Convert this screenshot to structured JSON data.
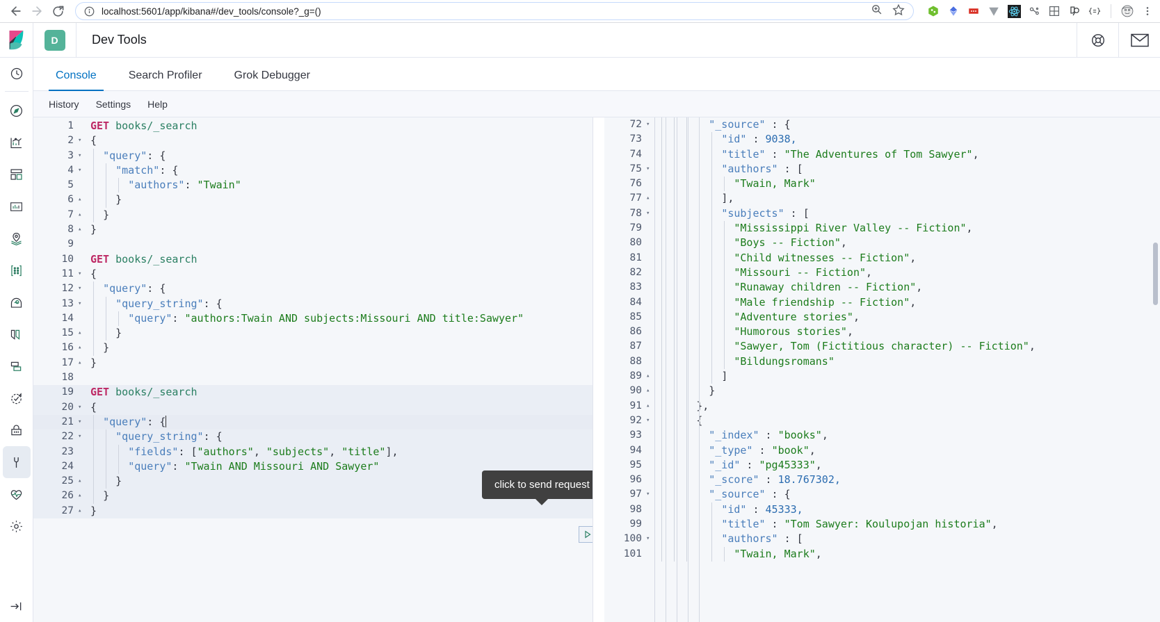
{
  "browser": {
    "back_label": "Back",
    "forward_label": "Forward",
    "reload_label": "Reload",
    "url": "localhost:5601/app/kibana#/dev_tools/console?_g=()",
    "site_info_icon": "info-circle-icon",
    "zoom_icon": "zoom-in-icon",
    "bookmark_icon": "star-icon",
    "menu_icon": "kebab-menu-icon",
    "extensions": [
      "puzzle-green-icon",
      "diamond-blue-icon",
      "red-dots-icon",
      "v-grey-icon",
      "react-atom-icon",
      "graph-nodes-icon",
      "grid-table-icon",
      "magnifier-person-icon",
      "braces-icon"
    ],
    "profile_icon": "avatar-icon"
  },
  "header": {
    "logo_icon": "kibana-logo-icon",
    "app_badge": "D",
    "title": "Dev Tools",
    "help_icon": "lifebuoy-icon",
    "mail_icon": "envelope-icon"
  },
  "sidebar": {
    "items": [
      {
        "name": "recently-viewed",
        "icon": "clock-icon",
        "selected": false
      },
      {
        "name": "discover",
        "icon": "compass-icon",
        "selected": false
      },
      {
        "name": "visualize",
        "icon": "chart-icon",
        "selected": false
      },
      {
        "name": "dashboard",
        "icon": "dashboard-icon",
        "selected": false
      },
      {
        "name": "canvas",
        "icon": "canvas-icon",
        "selected": false
      },
      {
        "name": "maps",
        "icon": "map-pin-icon",
        "selected": false
      },
      {
        "name": "machine-learning",
        "icon": "ml-nodes-icon",
        "selected": false
      },
      {
        "name": "infrastructure",
        "icon": "infra-icon",
        "selected": false
      },
      {
        "name": "logs",
        "icon": "logs-icon",
        "selected": false
      },
      {
        "name": "apm",
        "icon": "apm-icon",
        "selected": false
      },
      {
        "name": "uptime",
        "icon": "uptime-check-icon",
        "selected": false
      },
      {
        "name": "siem",
        "icon": "lock-icon",
        "selected": false
      },
      {
        "name": "dev-tools",
        "icon": "wrench-icon",
        "selected": true
      },
      {
        "name": "monitoring",
        "icon": "heart-pulse-icon",
        "selected": false
      },
      {
        "name": "management",
        "icon": "gear-icon",
        "selected": false
      }
    ],
    "collapse_icon": "collapse-arrow-icon"
  },
  "tabs": [
    {
      "label": "Console",
      "active": true
    },
    {
      "label": "Search Profiler",
      "active": false
    },
    {
      "label": "Grok Debugger",
      "active": false
    }
  ],
  "subbar": [
    {
      "label": "History"
    },
    {
      "label": "Settings"
    },
    {
      "label": "Help"
    }
  ],
  "tooltip": {
    "text": "click to send request"
  },
  "editor_actions": {
    "play_icon": "play-triangle-icon",
    "wrench_icon": "wrench-icon"
  },
  "editor": {
    "lines": [
      {
        "n": 1,
        "fold": "",
        "indent": 0,
        "tokens": [
          {
            "t": "method",
            "v": "GET"
          },
          {
            "t": "plain",
            "v": " "
          },
          {
            "t": "url",
            "v": "books/_search"
          }
        ]
      },
      {
        "n": 2,
        "fold": "▾",
        "indent": 0,
        "tokens": [
          {
            "t": "punc",
            "v": "{"
          }
        ]
      },
      {
        "n": 3,
        "fold": "▾",
        "indent": 1,
        "tokens": [
          {
            "t": "key",
            "v": "\"query\""
          },
          {
            "t": "punc",
            "v": ": {"
          }
        ]
      },
      {
        "n": 4,
        "fold": "▾",
        "indent": 2,
        "tokens": [
          {
            "t": "key",
            "v": "\"match\""
          },
          {
            "t": "punc",
            "v": ": {"
          }
        ]
      },
      {
        "n": 5,
        "fold": "",
        "indent": 3,
        "tokens": [
          {
            "t": "key",
            "v": "\"authors\""
          },
          {
            "t": "punc",
            "v": ": "
          },
          {
            "t": "str",
            "v": "\"Twain\""
          }
        ]
      },
      {
        "n": 6,
        "fold": "▴",
        "indent": 2,
        "tokens": [
          {
            "t": "punc",
            "v": "}"
          }
        ]
      },
      {
        "n": 7,
        "fold": "▴",
        "indent": 1,
        "tokens": [
          {
            "t": "punc",
            "v": "}"
          }
        ]
      },
      {
        "n": 8,
        "fold": "▴",
        "indent": 0,
        "tokens": [
          {
            "t": "punc",
            "v": "}"
          }
        ]
      },
      {
        "n": 9,
        "fold": "",
        "indent": 0,
        "tokens": []
      },
      {
        "n": 10,
        "fold": "",
        "indent": 0,
        "tokens": [
          {
            "t": "method",
            "v": "GET"
          },
          {
            "t": "plain",
            "v": " "
          },
          {
            "t": "url",
            "v": "books/_search"
          }
        ]
      },
      {
        "n": 11,
        "fold": "▾",
        "indent": 0,
        "tokens": [
          {
            "t": "punc",
            "v": "{"
          }
        ]
      },
      {
        "n": 12,
        "fold": "▾",
        "indent": 1,
        "tokens": [
          {
            "t": "key",
            "v": "\"query\""
          },
          {
            "t": "punc",
            "v": ": {"
          }
        ]
      },
      {
        "n": 13,
        "fold": "▾",
        "indent": 2,
        "tokens": [
          {
            "t": "key",
            "v": "\"query_string\""
          },
          {
            "t": "punc",
            "v": ": {"
          }
        ]
      },
      {
        "n": 14,
        "fold": "",
        "indent": 3,
        "tokens": [
          {
            "t": "key",
            "v": "\"query\""
          },
          {
            "t": "punc",
            "v": ": "
          },
          {
            "t": "str",
            "v": "\"authors:Twain AND subjects:Missouri AND title:Sawyer\""
          }
        ]
      },
      {
        "n": 15,
        "fold": "▴",
        "indent": 2,
        "tokens": [
          {
            "t": "punc",
            "v": "}"
          }
        ]
      },
      {
        "n": 16,
        "fold": "▴",
        "indent": 1,
        "tokens": [
          {
            "t": "punc",
            "v": "}"
          }
        ]
      },
      {
        "n": 17,
        "fold": "▴",
        "indent": 0,
        "tokens": [
          {
            "t": "punc",
            "v": "}"
          }
        ]
      },
      {
        "n": 18,
        "fold": "",
        "indent": 0,
        "tokens": []
      },
      {
        "n": 19,
        "fold": "",
        "indent": 0,
        "hl": true,
        "tokens": [
          {
            "t": "method",
            "v": "GET"
          },
          {
            "t": "plain",
            "v": " "
          },
          {
            "t": "url",
            "v": "books/_search"
          }
        ]
      },
      {
        "n": 20,
        "fold": "▾",
        "indent": 0,
        "hl": true,
        "tokens": [
          {
            "t": "punc",
            "v": "{"
          }
        ]
      },
      {
        "n": 21,
        "fold": "▾",
        "indent": 1,
        "cursor": true,
        "active": true,
        "tokens": [
          {
            "t": "key",
            "v": "\"query\""
          },
          {
            "t": "punc",
            "v": ": {"
          }
        ]
      },
      {
        "n": 22,
        "fold": "▾",
        "indent": 2,
        "hl": true,
        "tokens": [
          {
            "t": "key",
            "v": "\"query_string\""
          },
          {
            "t": "punc",
            "v": ": {"
          }
        ]
      },
      {
        "n": 23,
        "fold": "",
        "indent": 3,
        "hl": true,
        "tokens": [
          {
            "t": "key",
            "v": "\"fields\""
          },
          {
            "t": "punc",
            "v": ": ["
          },
          {
            "t": "str",
            "v": "\"authors\""
          },
          {
            "t": "punc",
            "v": ", "
          },
          {
            "t": "str",
            "v": "\"subjects\""
          },
          {
            "t": "punc",
            "v": ", "
          },
          {
            "t": "str",
            "v": "\"title\""
          },
          {
            "t": "punc",
            "v": "],"
          }
        ]
      },
      {
        "n": 24,
        "fold": "",
        "indent": 3,
        "hl": true,
        "tokens": [
          {
            "t": "key",
            "v": "\"query\""
          },
          {
            "t": "punc",
            "v": ": "
          },
          {
            "t": "str",
            "v": "\"Twain AND Missouri AND Sawyer\""
          }
        ]
      },
      {
        "n": 25,
        "fold": "▴",
        "indent": 2,
        "hl": true,
        "tokens": [
          {
            "t": "punc",
            "v": "}"
          }
        ]
      },
      {
        "n": 26,
        "fold": "▴",
        "indent": 1,
        "hl": true,
        "tokens": [
          {
            "t": "punc",
            "v": "}"
          }
        ]
      },
      {
        "n": 27,
        "fold": "▴",
        "indent": 0,
        "hl": true,
        "tokens": [
          {
            "t": "punc",
            "v": "}"
          }
        ]
      }
    ]
  },
  "output": {
    "lines": [
      {
        "n": 72,
        "fold": "▾",
        "indent": 4,
        "tokens": [
          {
            "t": "key",
            "v": "\"_source\""
          },
          {
            "t": "punc",
            "v": " : {"
          }
        ]
      },
      {
        "n": 73,
        "fold": "",
        "indent": 5,
        "tokens": [
          {
            "t": "key",
            "v": "\"id\""
          },
          {
            "t": "punc",
            "v": " : "
          },
          {
            "t": "num",
            "v": "9038,"
          }
        ]
      },
      {
        "n": 74,
        "fold": "",
        "indent": 5,
        "tokens": [
          {
            "t": "key",
            "v": "\"title\""
          },
          {
            "t": "punc",
            "v": " : "
          },
          {
            "t": "str",
            "v": "\"The Adventures of Tom Sawyer\""
          },
          {
            "t": "punc",
            "v": ","
          }
        ]
      },
      {
        "n": 75,
        "fold": "▾",
        "indent": 5,
        "tokens": [
          {
            "t": "key",
            "v": "\"authors\""
          },
          {
            "t": "punc",
            "v": " : ["
          }
        ]
      },
      {
        "n": 76,
        "fold": "",
        "indent": 6,
        "tokens": [
          {
            "t": "str",
            "v": "\"Twain, Mark\""
          }
        ]
      },
      {
        "n": 77,
        "fold": "▴",
        "indent": 5,
        "tokens": [
          {
            "t": "punc",
            "v": "],"
          }
        ]
      },
      {
        "n": 78,
        "fold": "▾",
        "indent": 5,
        "tokens": [
          {
            "t": "key",
            "v": "\"subjects\""
          },
          {
            "t": "punc",
            "v": " : ["
          }
        ]
      },
      {
        "n": 79,
        "fold": "",
        "indent": 6,
        "tokens": [
          {
            "t": "str",
            "v": "\"Mississippi River Valley -- Fiction\""
          },
          {
            "t": "punc",
            "v": ","
          }
        ]
      },
      {
        "n": 80,
        "fold": "",
        "indent": 6,
        "tokens": [
          {
            "t": "str",
            "v": "\"Boys -- Fiction\""
          },
          {
            "t": "punc",
            "v": ","
          }
        ]
      },
      {
        "n": 81,
        "fold": "",
        "indent": 6,
        "tokens": [
          {
            "t": "str",
            "v": "\"Child witnesses -- Fiction\""
          },
          {
            "t": "punc",
            "v": ","
          }
        ]
      },
      {
        "n": 82,
        "fold": "",
        "indent": 6,
        "tokens": [
          {
            "t": "str",
            "v": "\"Missouri -- Fiction\""
          },
          {
            "t": "punc",
            "v": ","
          }
        ]
      },
      {
        "n": 83,
        "fold": "",
        "indent": 6,
        "tokens": [
          {
            "t": "str",
            "v": "\"Runaway children -- Fiction\""
          },
          {
            "t": "punc",
            "v": ","
          }
        ]
      },
      {
        "n": 84,
        "fold": "",
        "indent": 6,
        "tokens": [
          {
            "t": "str",
            "v": "\"Male friendship -- Fiction\""
          },
          {
            "t": "punc",
            "v": ","
          }
        ]
      },
      {
        "n": 85,
        "fold": "",
        "indent": 6,
        "tokens": [
          {
            "t": "str",
            "v": "\"Adventure stories\""
          },
          {
            "t": "punc",
            "v": ","
          }
        ]
      },
      {
        "n": 86,
        "fold": "",
        "indent": 6,
        "tokens": [
          {
            "t": "str",
            "v": "\"Humorous stories\""
          },
          {
            "t": "punc",
            "v": ","
          }
        ]
      },
      {
        "n": 87,
        "fold": "",
        "indent": 6,
        "tokens": [
          {
            "t": "str",
            "v": "\"Sawyer, Tom (Fictitious character) -- Fiction\""
          },
          {
            "t": "punc",
            "v": ","
          }
        ]
      },
      {
        "n": 88,
        "fold": "",
        "indent": 6,
        "tokens": [
          {
            "t": "str",
            "v": "\"Bildungsromans\""
          }
        ]
      },
      {
        "n": 89,
        "fold": "▴",
        "indent": 5,
        "tokens": [
          {
            "t": "punc",
            "v": "]"
          }
        ]
      },
      {
        "n": 90,
        "fold": "▴",
        "indent": 4,
        "tokens": [
          {
            "t": "punc",
            "v": "}"
          }
        ]
      },
      {
        "n": 91,
        "fold": "▴",
        "indent": 3,
        "tokens": [
          {
            "t": "punc",
            "v": "},"
          }
        ]
      },
      {
        "n": 92,
        "fold": "▾",
        "indent": 3,
        "tokens": [
          {
            "t": "punc",
            "v": "{"
          }
        ]
      },
      {
        "n": 93,
        "fold": "",
        "indent": 4,
        "tokens": [
          {
            "t": "key",
            "v": "\"_index\""
          },
          {
            "t": "punc",
            "v": " : "
          },
          {
            "t": "str",
            "v": "\"books\""
          },
          {
            "t": "punc",
            "v": ","
          }
        ]
      },
      {
        "n": 94,
        "fold": "",
        "indent": 4,
        "tokens": [
          {
            "t": "key",
            "v": "\"_type\""
          },
          {
            "t": "punc",
            "v": " : "
          },
          {
            "t": "str",
            "v": "\"book\""
          },
          {
            "t": "punc",
            "v": ","
          }
        ]
      },
      {
        "n": 95,
        "fold": "",
        "indent": 4,
        "tokens": [
          {
            "t": "key",
            "v": "\"_id\""
          },
          {
            "t": "punc",
            "v": " : "
          },
          {
            "t": "str",
            "v": "\"pg45333\""
          },
          {
            "t": "punc",
            "v": ","
          }
        ]
      },
      {
        "n": 96,
        "fold": "",
        "indent": 4,
        "tokens": [
          {
            "t": "key",
            "v": "\"_score\""
          },
          {
            "t": "punc",
            "v": " : "
          },
          {
            "t": "num",
            "v": "18.767302,"
          }
        ]
      },
      {
        "n": 97,
        "fold": "▾",
        "indent": 4,
        "tokens": [
          {
            "t": "key",
            "v": "\"_source\""
          },
          {
            "t": "punc",
            "v": " : {"
          }
        ]
      },
      {
        "n": 98,
        "fold": "",
        "indent": 5,
        "tokens": [
          {
            "t": "key",
            "v": "\"id\""
          },
          {
            "t": "punc",
            "v": " : "
          },
          {
            "t": "num",
            "v": "45333,"
          }
        ]
      },
      {
        "n": 99,
        "fold": "",
        "indent": 5,
        "tokens": [
          {
            "t": "key",
            "v": "\"title\""
          },
          {
            "t": "punc",
            "v": " : "
          },
          {
            "t": "str",
            "v": "\"Tom Sawyer: Koulupojan historia\""
          },
          {
            "t": "punc",
            "v": ","
          }
        ]
      },
      {
        "n": 100,
        "fold": "▾",
        "indent": 5,
        "tokens": [
          {
            "t": "key",
            "v": "\"authors\""
          },
          {
            "t": "punc",
            "v": " : ["
          }
        ]
      },
      {
        "n": 101,
        "fold": "",
        "indent": 6,
        "tokens": [
          {
            "t": "str",
            "v": "\"Twain, Mark\""
          },
          {
            "t": "punc",
            "v": ","
          }
        ]
      }
    ]
  },
  "colors": {
    "accent": "#0071c2",
    "badge_green": "#54b399",
    "method": "#bd2864",
    "string": "#1c7c1c",
    "key": "#4a7ebb",
    "url": "#2a7f62",
    "tooltip_bg": "#404040"
  }
}
